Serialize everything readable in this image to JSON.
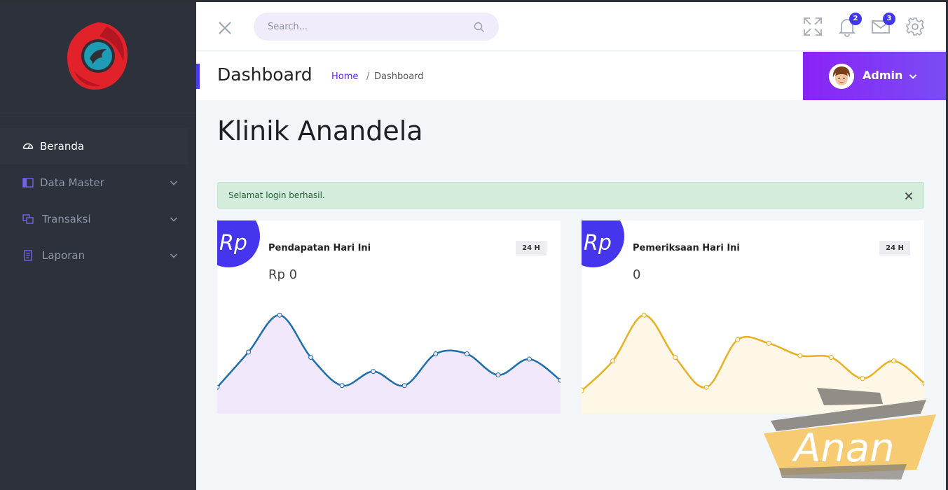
{
  "sidebar": {
    "items": [
      {
        "label": "Beranda",
        "icon": "dashboard-icon",
        "active": true
      },
      {
        "label": "Data Master",
        "icon": "columns-icon",
        "active": false
      },
      {
        "label": "Transaksi",
        "icon": "copy-icon",
        "active": false
      },
      {
        "label": "Laporan",
        "icon": "report-icon",
        "active": false
      }
    ]
  },
  "header": {
    "search_placeholder": "Search...",
    "notifications_count": "2",
    "messages_count": "3"
  },
  "subheader": {
    "title": "Dashboard",
    "breadcrumb_home": "Home",
    "breadcrumb_sep": "/",
    "breadcrumb_current": "Dashboard",
    "user_name": "Admin"
  },
  "main": {
    "title": "Klinik Anandela",
    "alert_text": "Selamat login berhasil."
  },
  "cards": [
    {
      "icon_text": "Rp",
      "title": "Pendapatan Hari Ini",
      "badge": "24 H",
      "value": "Rp 0"
    },
    {
      "icon_text": "Rp",
      "title": "Pemeriksaan Hari Ini",
      "badge": "24 H",
      "value": "0"
    }
  ],
  "chart_data": [
    {
      "type": "area",
      "series": [
        {
          "values": [
            15,
            35,
            56,
            32,
            16,
            24,
            16,
            34,
            34,
            22,
            31,
            19
          ]
        }
      ],
      "ylim": [
        0,
        70
      ],
      "color": "#1c6ead",
      "fill": "#f1e8fc"
    },
    {
      "type": "area",
      "series": [
        {
          "values": [
            13,
            30,
            56,
            32,
            15,
            42,
            40,
            33,
            32,
            20,
            30,
            17
          ]
        }
      ],
      "ylim": [
        0,
        70
      ],
      "color": "#e9b020",
      "fill": "#fdf7e8"
    }
  ],
  "watermark": {
    "text": "Anan"
  },
  "colors": {
    "sidebar_bg": "#2d313c",
    "accent": "#4536ee",
    "admin_gradient_start": "#8a23f6",
    "admin_gradient_end": "#7a4cf4",
    "alert_bg": "#d4ecdc"
  }
}
